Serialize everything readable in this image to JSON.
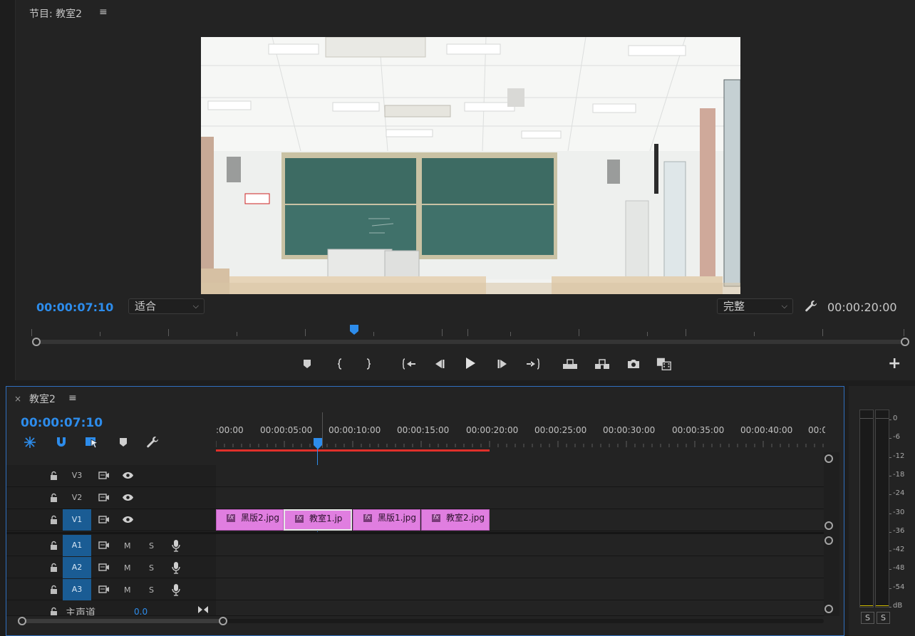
{
  "program_monitor": {
    "title": "节目: 教室2",
    "current_timecode": "00:00:07:10",
    "zoom_select": "适合",
    "quality_select": "完整",
    "duration_timecode": "00:00:20:00",
    "video_description": "classroom"
  },
  "transport": {
    "buttons": [
      "add-marker",
      "mark-in",
      "mark-out",
      "go-to-in",
      "step-back",
      "play",
      "step-forward",
      "go-to-out",
      "lift",
      "extract",
      "export-frame",
      "compare"
    ]
  },
  "timeline": {
    "close_label": "×",
    "sequence_name": "教室2",
    "current_timecode": "00:00:07:10",
    "ruler_labels": [
      ":00:00",
      "00:00:05:00",
      "00:00:10:00",
      "00:00:15:00",
      "00:00:20:00",
      "00:00:25:00",
      "00:00:30:00",
      "00:00:35:00",
      "00:00:40:00",
      "00:0("
    ],
    "video_tracks": [
      {
        "label": "V3",
        "active": false
      },
      {
        "label": "V2",
        "active": false
      },
      {
        "label": "V1",
        "active": true
      }
    ],
    "audio_tracks": [
      {
        "label": "A1",
        "mute": "M",
        "solo": "S"
      },
      {
        "label": "A2",
        "mute": "M",
        "solo": "S"
      },
      {
        "label": "A3",
        "mute": "M",
        "solo": "S"
      }
    ],
    "master": {
      "label": "主声道",
      "value": "0.0"
    },
    "clips": [
      {
        "name": "黑版2.jpg",
        "fx": "fx"
      },
      {
        "name": "教室1.jp",
        "fx": "fx"
      },
      {
        "name": "黑版1.jpg",
        "fx": "fx"
      },
      {
        "name": "教室2.jpg",
        "fx": "fx"
      }
    ]
  },
  "audio_meter": {
    "scale": [
      "0",
      "-6",
      "-12",
      "-18",
      "-24",
      "-30",
      "-36",
      "-42",
      "-48",
      "-54",
      "dB"
    ],
    "solo_left": "S",
    "solo_right": "S"
  },
  "colors": {
    "accent_blue": "#2d8ceb",
    "clip_pink": "#e07ee0",
    "work_area_red": "#e0302a",
    "track_active": "#1a5c94"
  }
}
